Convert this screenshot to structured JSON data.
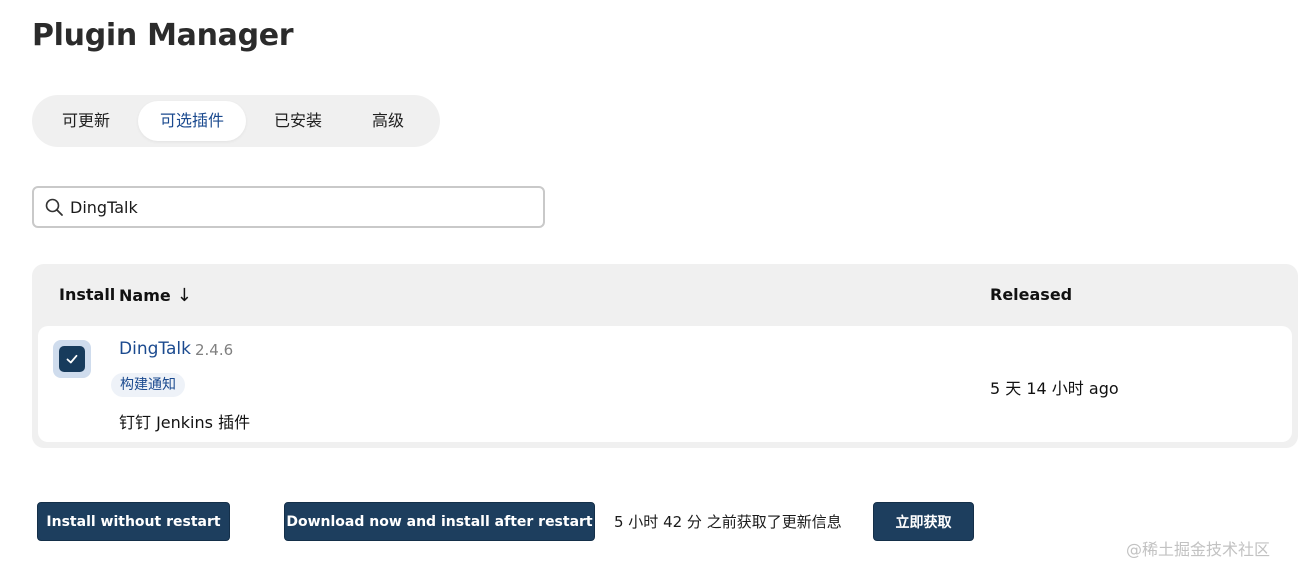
{
  "page": {
    "title": "Plugin Manager"
  },
  "tabs": [
    {
      "label": "可更新",
      "active": false
    },
    {
      "label": "可选插件",
      "active": true
    },
    {
      "label": "已安装",
      "active": false
    },
    {
      "label": "高级",
      "active": false
    }
  ],
  "search": {
    "value": "DingTalk",
    "icon": "search-icon"
  },
  "table": {
    "headers": {
      "install": "Install",
      "name": "Name",
      "sort_indicator": "↓",
      "released": "Released"
    },
    "rows": [
      {
        "checked": true,
        "name": "DingTalk",
        "version": "2.4.6",
        "tag": "构建通知",
        "description": "钉钉 Jenkins 插件",
        "released": "5 天 14 小时 ago"
      }
    ]
  },
  "actions": {
    "install_without_restart": "Install without restart",
    "download_and_install_after_restart": "Download now and install after restart",
    "update_info": "5 小时 42 分 之前获取了更新信息",
    "fetch_now": "立即获取"
  },
  "watermark": "@稀土掘金技术社区",
  "colors": {
    "accent": "#1b4a8f",
    "button_bg": "#1d3e5e",
    "checkbox_bg": "#173b5c",
    "panel_bg": "#f0f0f0"
  }
}
